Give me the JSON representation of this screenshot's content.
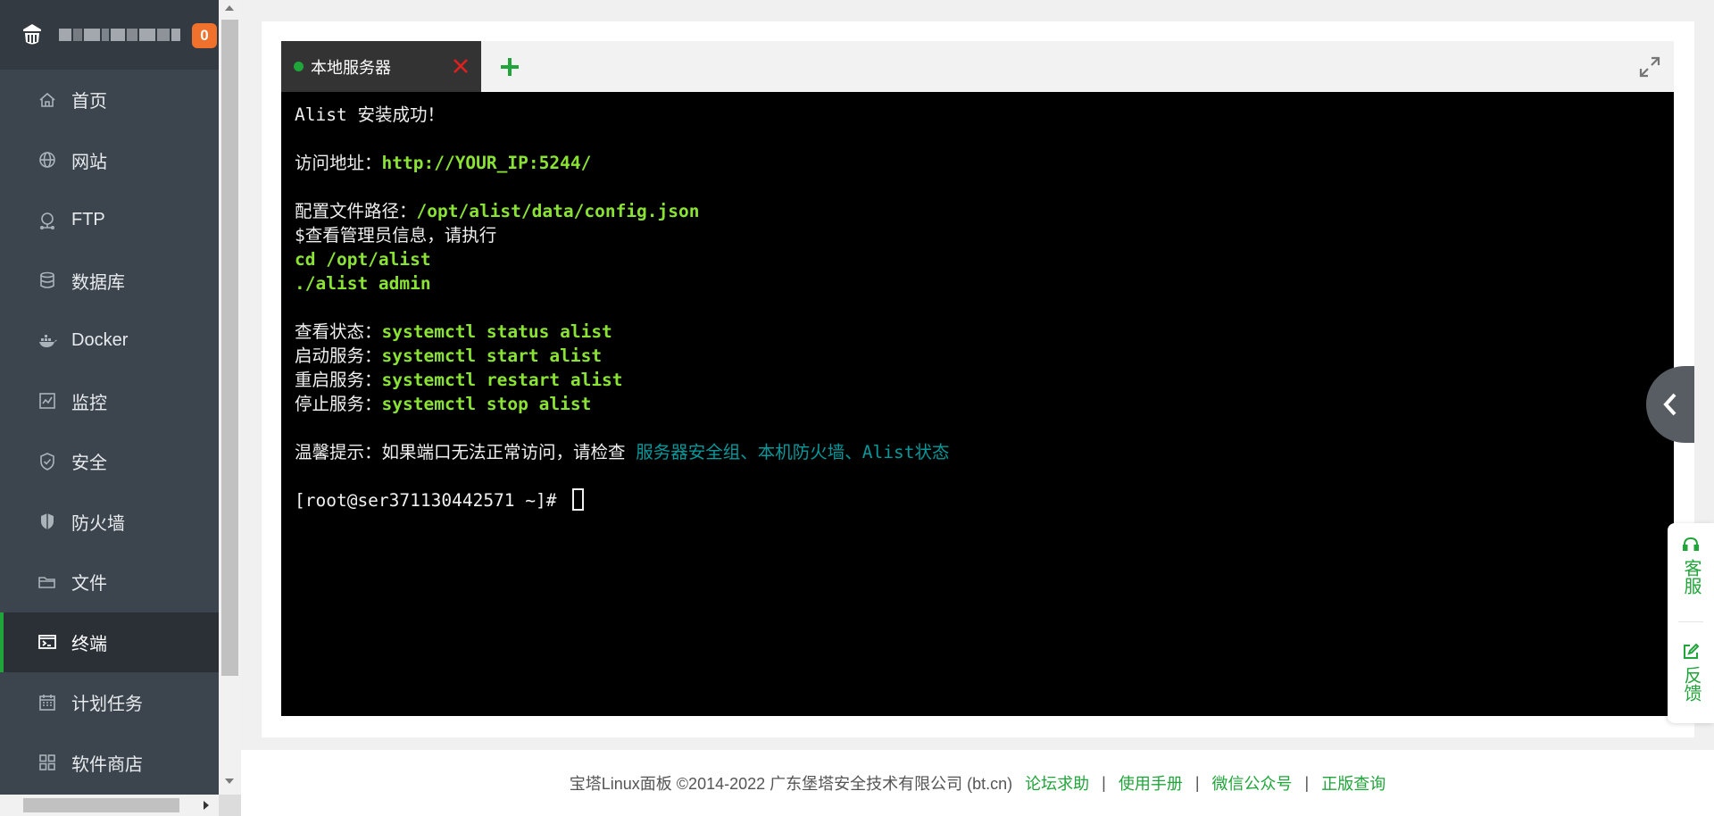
{
  "brand": {
    "notification_count": "0"
  },
  "sidebar": {
    "items": [
      {
        "label": "首页",
        "icon": "home-icon"
      },
      {
        "label": "网站",
        "icon": "globe-icon"
      },
      {
        "label": "FTP",
        "icon": "ftp-icon"
      },
      {
        "label": "数据库",
        "icon": "database-icon"
      },
      {
        "label": "Docker",
        "icon": "docker-icon"
      },
      {
        "label": "监控",
        "icon": "monitor-icon"
      },
      {
        "label": "安全",
        "icon": "shield-check-icon"
      },
      {
        "label": "防火墙",
        "icon": "firewall-shield-icon"
      },
      {
        "label": "文件",
        "icon": "folder-icon"
      },
      {
        "label": "终端",
        "icon": "terminal-icon",
        "active": true
      },
      {
        "label": "计划任务",
        "icon": "calendar-icon"
      },
      {
        "label": "软件商店",
        "icon": "grid-apps-icon"
      }
    ]
  },
  "terminal": {
    "tab_label": "本地服务器",
    "tab_status_color": "#20a53a",
    "lines": {
      "l1": "Alist 安装成功！",
      "l2_prefix": "访问地址：",
      "l2_value": "http://YOUR_IP:5244/",
      "l3_prefix": "配置文件路径：",
      "l3_value": "/opt/alist/data/config.json",
      "l4": "$查看管理员信息，请执行",
      "l5": "cd /opt/alist",
      "l6": "./alist admin",
      "l7_prefix": "查看状态：",
      "l7_value": "systemctl status alist",
      "l8_prefix": "启动服务：",
      "l8_value": "systemctl start alist",
      "l9_prefix": "重启服务：",
      "l9_value": "systemctl restart alist",
      "l10_prefix": "停止服务：",
      "l10_value": "systemctl stop alist",
      "l11_prefix": "温馨提示：如果端口无法正常访问，请检查 ",
      "l11_value": "服务器安全组、本机防火墙、Alist状态",
      "prompt": "[root@ser371130442571 ~]# "
    }
  },
  "float_tools": {
    "service_label": "客服",
    "feedback_label": "反馈"
  },
  "footer": {
    "copyright": "宝塔Linux面板 ©2014-2022 广东堡塔安全技术有限公司 (bt.cn)",
    "links": [
      "论坛求助",
      "使用手册",
      "微信公众号",
      "正版查询"
    ],
    "separator": "|"
  },
  "colors": {
    "accent": "#20a53a",
    "sidebar_bg": "#3c444d",
    "badge": "#f0712b",
    "terminal_green": "#8ae234",
    "terminal_cyan": "#06989a"
  }
}
